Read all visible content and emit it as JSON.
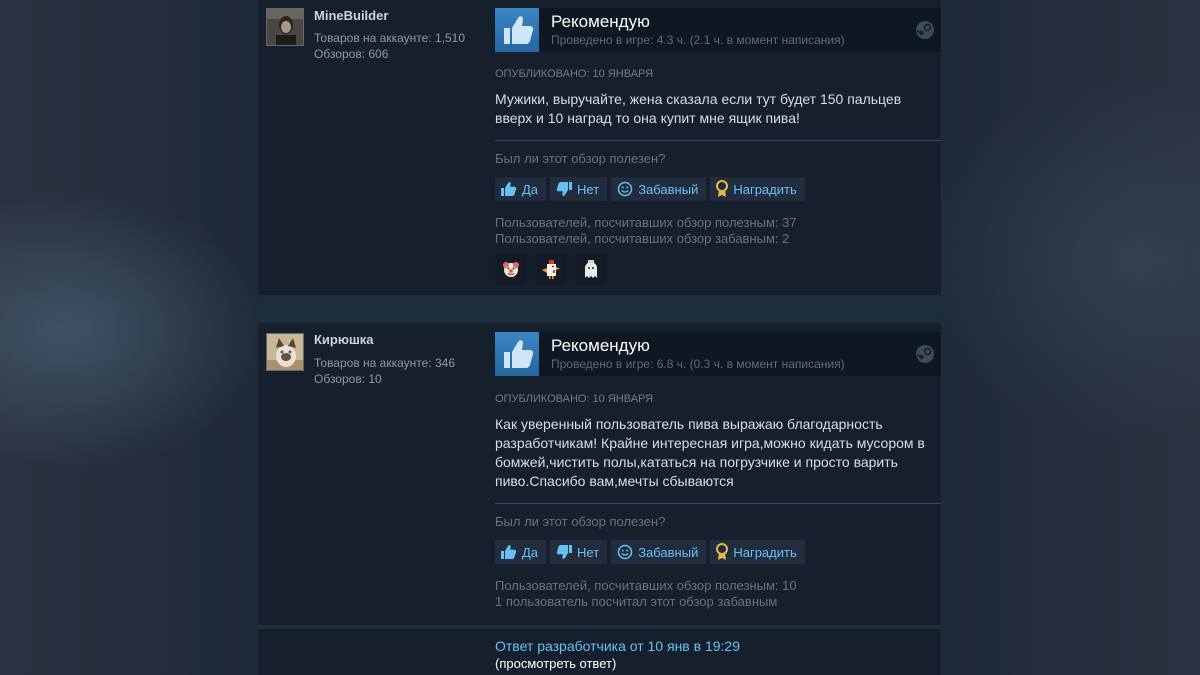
{
  "reviews": [
    {
      "author": "MineBuilder",
      "products": "Товаров на аккаунте: 1,510",
      "reviews_count": "Обзоров: 606",
      "recommendation": "Рекомендую",
      "hours": "Проведено в игре: 4.3 ч. (2.1 ч. в момент написания)",
      "posted": "Опубликовано: 10 января",
      "text": "Мужики, выручайте, жена сказала если тут будет 150 пальцев вверх и 10 наград то она купит мне ящик пива!",
      "helpful_question": "Был ли этот обзор полезен?",
      "buttons": {
        "yes": "Да",
        "no": "Нет",
        "funny": "Забавный",
        "award": "Наградить"
      },
      "helpful_stat": "Пользователей, посчитавших обзор полезным: 37",
      "funny_stat": "Пользователей, посчитавших обзор забавным: 2",
      "awards": [
        "clown-award-icon",
        "rooster-award-icon",
        "ghost-award-icon"
      ]
    },
    {
      "author": "Кирюшка",
      "products": "Товаров на аккаунте: 346",
      "reviews_count": "Обзоров: 10",
      "recommendation": "Рекомендую",
      "hours": "Проведено в игре: 6.8 ч. (0.3 ч. в момент написания)",
      "posted": "Опубликовано: 10 января",
      "text": "Как уверенный пользователь пива выражаю благодарность разработчикам! Крайне интересная игра,можно кидать мусором в бомжей,чистить полы,кататься на погрузчике и просто варить пиво.Спасибо вам,мечты сбываются",
      "helpful_question": "Был ли этот обзор полезен?",
      "buttons": {
        "yes": "Да",
        "no": "Нет",
        "funny": "Забавный",
        "award": "Наградить"
      },
      "helpful_stat": "Пользователей, посчитавших обзор полезным: 10",
      "funny_stat": "1 пользователь посчитал этот обзор забавным"
    }
  ],
  "developer_response": {
    "link": "Ответ разработчика от 10 янв в 19:29",
    "view": "(просмотреть ответ)"
  },
  "colors": {
    "accent": "#66c0f4",
    "thumb": "#2a6aa0",
    "panel": "#16202d",
    "header": "#0e1722"
  }
}
